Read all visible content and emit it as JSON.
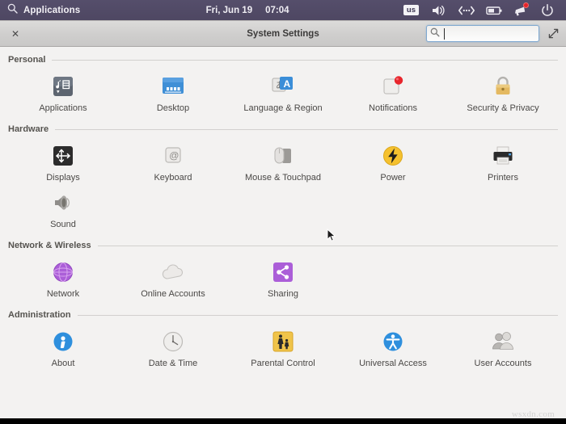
{
  "panel": {
    "search_icon": "search-icon",
    "applications_label": "Applications",
    "date": "Fri, Jun 19",
    "time": "07:04",
    "keyboard_layout": "us",
    "tray": [
      {
        "name": "volume-icon",
        "label": "Volume"
      },
      {
        "name": "network-icon",
        "label": "Network"
      },
      {
        "name": "battery-icon",
        "label": "Battery"
      },
      {
        "name": "notifications-icon",
        "label": "Notifications"
      },
      {
        "name": "power-icon",
        "label": "Power"
      }
    ],
    "bg_color": "#4e4762"
  },
  "window": {
    "title": "System Settings",
    "close_label": "✕",
    "expand_label": "⤡",
    "search": {
      "value": "",
      "placeholder": ""
    }
  },
  "sections": [
    {
      "title": "Personal",
      "items": [
        {
          "label": "Applications",
          "icon": "applications-icon"
        },
        {
          "label": "Desktop",
          "icon": "desktop-icon"
        },
        {
          "label": "Language & Region",
          "icon": "language-region-icon"
        },
        {
          "label": "Notifications",
          "icon": "notifications-icon"
        },
        {
          "label": "Security & Privacy",
          "icon": "security-privacy-icon"
        }
      ]
    },
    {
      "title": "Hardware",
      "items": [
        {
          "label": "Displays",
          "icon": "displays-icon"
        },
        {
          "label": "Keyboard",
          "icon": "keyboard-icon"
        },
        {
          "label": "Mouse & Touchpad",
          "icon": "mouse-touchpad-icon"
        },
        {
          "label": "Power",
          "icon": "power-icon"
        },
        {
          "label": "Printers",
          "icon": "printers-icon"
        },
        {
          "label": "Sound",
          "icon": "sound-icon"
        }
      ]
    },
    {
      "title": "Network & Wireless",
      "items": [
        {
          "label": "Network",
          "icon": "network-icon"
        },
        {
          "label": "Online Accounts",
          "icon": "online-accounts-icon"
        },
        {
          "label": "Sharing",
          "icon": "sharing-icon"
        }
      ]
    },
    {
      "title": "Administration",
      "items": [
        {
          "label": "About",
          "icon": "about-icon"
        },
        {
          "label": "Date & Time",
          "icon": "date-time-icon"
        },
        {
          "label": "Parental Control",
          "icon": "parental-control-icon"
        },
        {
          "label": "Universal Access",
          "icon": "universal-access-icon"
        },
        {
          "label": "User Accounts",
          "icon": "user-accounts-icon"
        }
      ]
    }
  ],
  "watermark": "wsxdn.com",
  "colors": {
    "panel": "#4e4762",
    "window_bg": "#f3f2f1",
    "titlebar": "#d2d1d0",
    "accent_blue": "#3b8ed8",
    "accent_purple": "#ab5ed8",
    "accent_yellow": "#f5c12e"
  }
}
